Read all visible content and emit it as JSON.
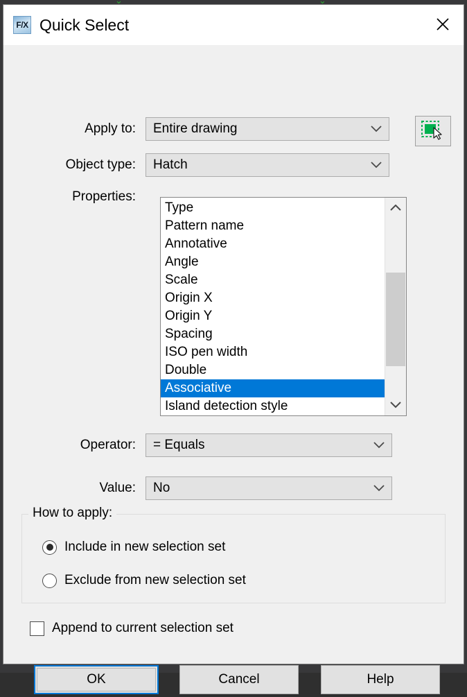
{
  "window": {
    "title": "Quick Select",
    "app_icon_text": "F/X",
    "close_icon": "close-icon"
  },
  "fields": {
    "apply_to": {
      "label": "Apply to:",
      "value": "Entire drawing",
      "chevron_icon": "chevron-down-icon"
    },
    "pick_objects": {
      "icon": "select-objects-icon",
      "cursor_icon": "mouse-cursor-icon"
    },
    "object_type": {
      "label": "Object type:",
      "value": "Hatch",
      "chevron_icon": "chevron-down-icon"
    },
    "properties": {
      "label": "Properties:",
      "items": [
        "Type",
        "Pattern name",
        "Annotative",
        "Angle",
        "Scale",
        "Origin X",
        "Origin Y",
        "Spacing",
        "ISO pen width",
        "Double",
        "Associative",
        "Island detection style"
      ],
      "selected_index": 10,
      "scrollbar": {
        "up_icon": "chevron-up-icon",
        "down_icon": "chevron-down-icon"
      }
    },
    "operator": {
      "label": "Operator:",
      "value": "= Equals",
      "chevron_icon": "chevron-down-icon"
    },
    "value": {
      "label": "Value:",
      "value": "No",
      "chevron_icon": "chevron-down-icon"
    }
  },
  "how_to_apply": {
    "legend": "How to apply:",
    "options": [
      {
        "label": "Include in new selection set",
        "checked": true
      },
      {
        "label": "Exclude from new selection set",
        "checked": false
      }
    ]
  },
  "append": {
    "label": "Append to current selection set",
    "checked": false
  },
  "buttons": {
    "ok": "OK",
    "cancel": "Cancel",
    "help": "Help"
  },
  "colors": {
    "selection_blue": "#0078d7",
    "dialog_bg": "#f0f0f0",
    "titlebar_bg": "#ffffff",
    "pick_icon_green": "#00b04f"
  }
}
